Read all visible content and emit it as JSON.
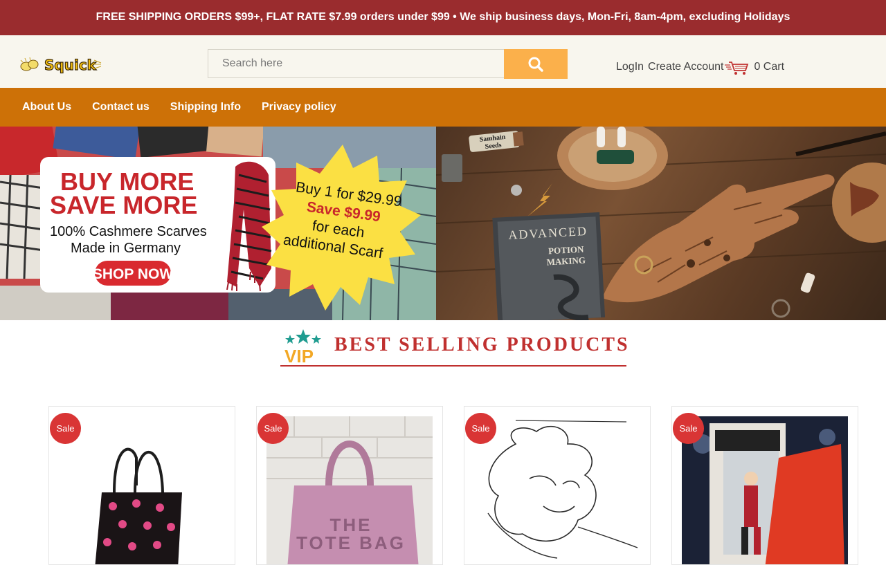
{
  "promo": {
    "text": "FREE SHIPPING ORDERS $99+, FLAT RATE $7.99 orders under $99 • We ship business days, Mon-Fri, 8am-4pm, excluding Holidays"
  },
  "header": {
    "logo_text": "Squick",
    "search_placeholder": "Search here",
    "login_label": "LogIn",
    "create_account_label": "Create Account",
    "cart_label": "0 Cart"
  },
  "nav": {
    "items": [
      {
        "label": "About Us"
      },
      {
        "label": "Contact us"
      },
      {
        "label": "Shipping Info"
      },
      {
        "label": "Privacy policy"
      }
    ]
  },
  "banner": {
    "headline_1": "BUY MORE",
    "headline_2": "SAVE MORE",
    "sub_1": "100% Cashmere Scarves",
    "sub_2": "Made in Germany",
    "cta": "SHOP NOW",
    "burst_1": "Buy 1 for $29.99",
    "burst_2": "Save $9.99",
    "burst_3": "for each",
    "burst_4": "additional Scarf",
    "book_1": "ADVANCED",
    "book_2": "POTION",
    "book_3": "MAKING",
    "jar_label_1": "Samhain",
    "jar_label_2": "Seeds"
  },
  "section": {
    "badge": "VIP",
    "title": "BEST SELLING PRODUCTS"
  },
  "products": [
    {
      "badge": "Sale"
    },
    {
      "badge": "Sale",
      "print_1": "THE",
      "print_2": "TOTE BAG"
    },
    {
      "badge": "Sale"
    },
    {
      "badge": "Sale"
    }
  ],
  "colors": {
    "promo_bg": "#9a2c2e",
    "header_bg": "#f8f6ee",
    "search_button": "#fbb04b",
    "nav_bg": "#cd7107",
    "accent_red": "#c0302f",
    "sale_badge": "#d93535"
  }
}
